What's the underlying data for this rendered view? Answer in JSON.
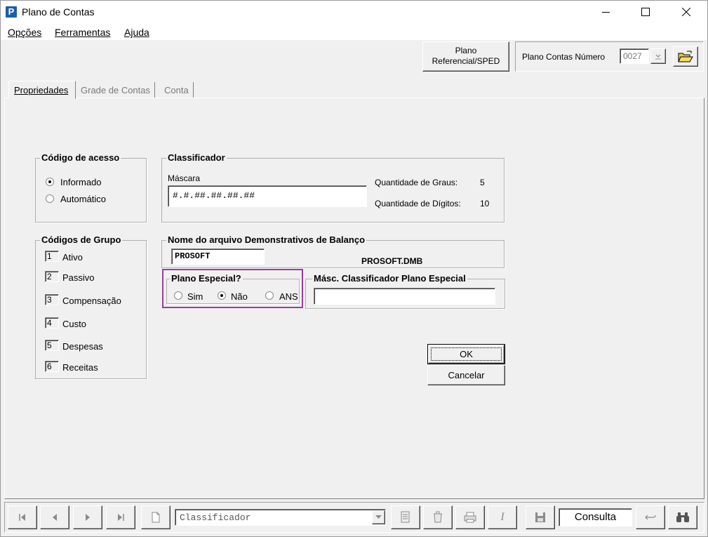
{
  "window": {
    "title": "Plano de Contas",
    "icon_letter": "P"
  },
  "menu": [
    "Opções",
    "Ferramentas",
    "Ajuda"
  ],
  "toolbar": {
    "plano_ref_line1": "Plano",
    "plano_ref_line2": "Referencial/SPED",
    "plano_numero_label": "Plano Contas Número",
    "plano_numero_value": "0027"
  },
  "tabs": [
    "Propriedades",
    "Grade de Contas",
    "Conta"
  ],
  "codigo_acesso": {
    "legend": "Código de acesso",
    "options": [
      "Informado",
      "Automático"
    ],
    "selected": "Informado"
  },
  "classificador": {
    "legend": "Classificador",
    "mascara_label": "Máscara",
    "mascara_value": "#.#.##.##.##.##",
    "graus_label": "Quantidade de Graus:",
    "graus_value": "5",
    "digitos_label": "Quantidade de Dígitos:",
    "digitos_value": "10"
  },
  "codigos_grupo": {
    "legend": "Códigos de Grupo",
    "items": [
      {
        "num": "1",
        "label": "Ativo"
      },
      {
        "num": "2",
        "label": "Passivo"
      },
      {
        "num": "3",
        "label": "Compensação"
      },
      {
        "num": "4",
        "label": "Custo"
      },
      {
        "num": "5",
        "label": "Despesas"
      },
      {
        "num": "6",
        "label": "Receitas"
      }
    ]
  },
  "arquivo_balanco": {
    "legend": "Nome do arquivo Demonstrativos de Balanço",
    "value": "PROSOFT",
    "filename": "PROSOFT.DMB"
  },
  "plano_especial": {
    "legend": "Plano Especial?",
    "options": [
      "Sim",
      "Não",
      "ANS"
    ],
    "selected": "Não",
    "highlight_color": "#9b3ca0"
  },
  "masc_especial": {
    "legend": "Másc. Classificador Plano Especial",
    "value": ""
  },
  "buttons": {
    "ok": "OK",
    "cancel": "Cancelar"
  },
  "statusbar": {
    "combo_value": "Classificador",
    "mode": "Consulta"
  }
}
